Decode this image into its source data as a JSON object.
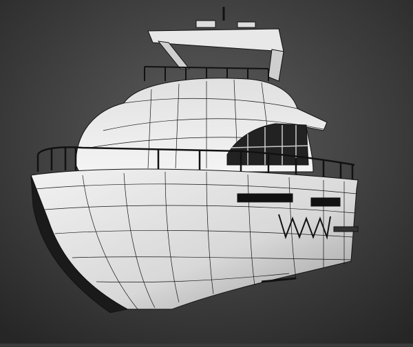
{
  "viewport": {
    "background_center": "#5e5e5e",
    "background_edge": "#262626",
    "model_fill": "#e6e6e6",
    "model_shadow": "#1a1a1a",
    "wire_color": "#111111"
  }
}
